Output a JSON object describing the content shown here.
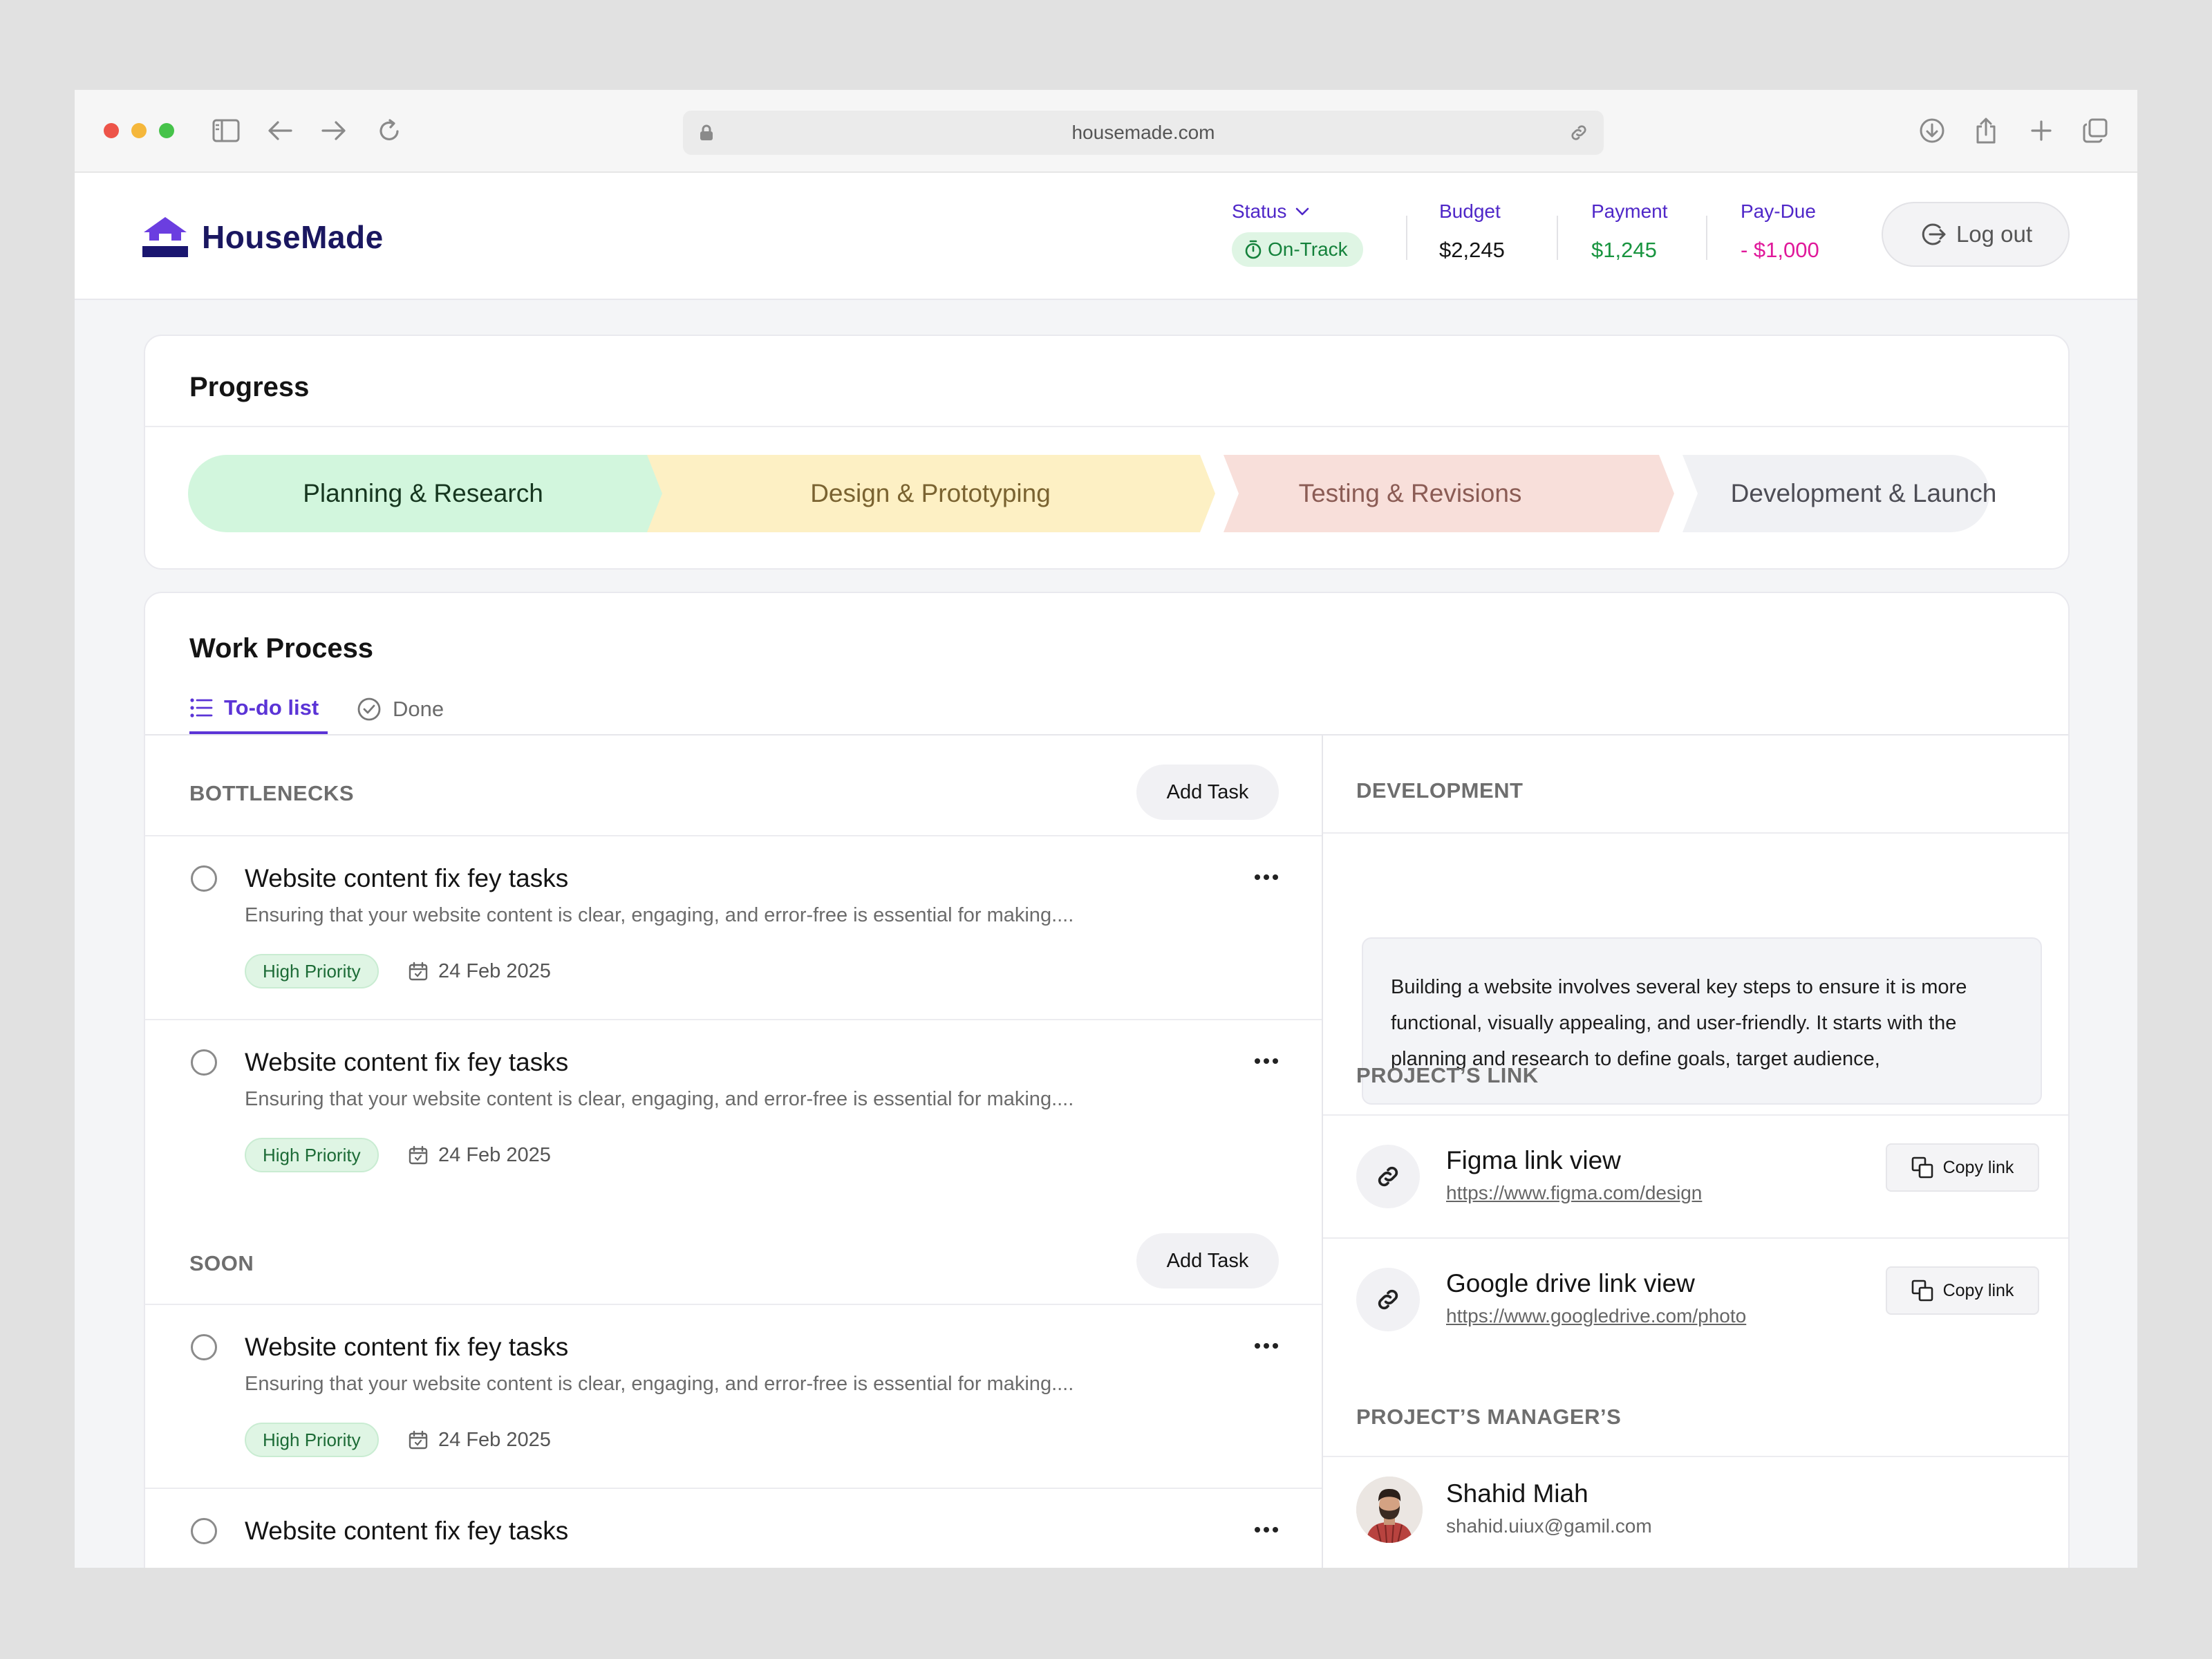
{
  "browser": {
    "url": "housemade.com"
  },
  "header": {
    "brand": "HouseMade",
    "status_label": "Status",
    "status_value": "On-Track",
    "budget_label": "Budget",
    "budget_value": "$2,245",
    "payment_label": "Payment",
    "payment_value": "$1,245",
    "paydue_label": "Pay-Due",
    "paydue_value": "- $1,000",
    "logout_label": "Log out"
  },
  "progress": {
    "title": "Progress",
    "stages": [
      {
        "label": "Planning & Research",
        "fill": "#d2f6dd",
        "text": "#16361f"
      },
      {
        "label": "Design & Prototyping",
        "fill": "#fdf0c4",
        "text": "#7a6331"
      },
      {
        "label": "Testing & Revisions",
        "fill": "#f8dfda",
        "text": "#8b5c55"
      },
      {
        "label": "Development & Launch",
        "fill": "#f0f1f4",
        "text": "#4d4d55"
      }
    ]
  },
  "work": {
    "title": "Work Process",
    "tabs": [
      {
        "label": "To-do list"
      },
      {
        "label": "Done"
      }
    ],
    "sections": [
      {
        "heading": "BOTTLENECKS",
        "add_label": "Add Task",
        "tasks": [
          {
            "title": "Website content fix fey tasks",
            "desc": "Ensuring that your website content is clear, engaging, and error-free is essential for making....",
            "priority": "High Priority",
            "date": "24 Feb 2025"
          },
          {
            "title": "Website content fix fey tasks",
            "desc": "Ensuring that your website content is clear, engaging, and error-free is essential for making....",
            "priority": "High Priority",
            "date": "24 Feb 2025"
          }
        ]
      },
      {
        "heading": "SOON",
        "add_label": "Add Task",
        "tasks": [
          {
            "title": "Website content fix fey tasks",
            "desc": "Ensuring that your website content is clear, engaging, and error-free is essential for making....",
            "priority": "High Priority",
            "date": "24 Feb 2025"
          },
          {
            "title": "Website content fix fey tasks"
          }
        ]
      }
    ]
  },
  "details": {
    "development_heading": "DEVELOPMENT",
    "development_text": "Building a website involves several key steps to ensure it is more functional, visually appealing, and user-friendly. It starts with the planning and research to define goals, target audience,",
    "links_heading": "PROJECT’S LINK",
    "links": [
      {
        "title": "Figma link view",
        "url": "https://www.figma.com/design",
        "copy_label": "Copy link"
      },
      {
        "title": "Google drive link view",
        "url": "https://www.googledrive.com/photo",
        "copy_label": "Copy link"
      }
    ],
    "managers_heading": "PROJECT’S MANAGER’S",
    "manager": {
      "name": "Shahid Miah",
      "email": "shahid.uiux@gamil.com"
    }
  }
}
